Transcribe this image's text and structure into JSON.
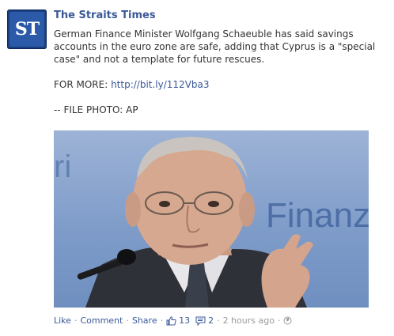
{
  "post": {
    "avatar_text": "ST",
    "page_name": "The Straits Times",
    "message": "German Finance Minister Wolfgang Schaeuble has said savings accounts in the euro zone are safe, adding that Cyprus is a \"special case\" and not a template for future rescues.",
    "for_more_label": "FOR MORE: ",
    "for_more_link": "http://bit.ly/112Vba3",
    "credit": "-- FILE PHOTO: AP",
    "photo_sign_text": "Finanzen",
    "photo_sign_text_left": "ri"
  },
  "actions": {
    "like": "Like",
    "comment": "Comment",
    "share": "Share",
    "likes_count": "13",
    "comments_count": "2",
    "timestamp": "2 hours ago"
  },
  "colors": {
    "brand": "#3b5998",
    "avatar_bg": "#1a3f7f",
    "text": "#333333",
    "muted": "#999999"
  }
}
